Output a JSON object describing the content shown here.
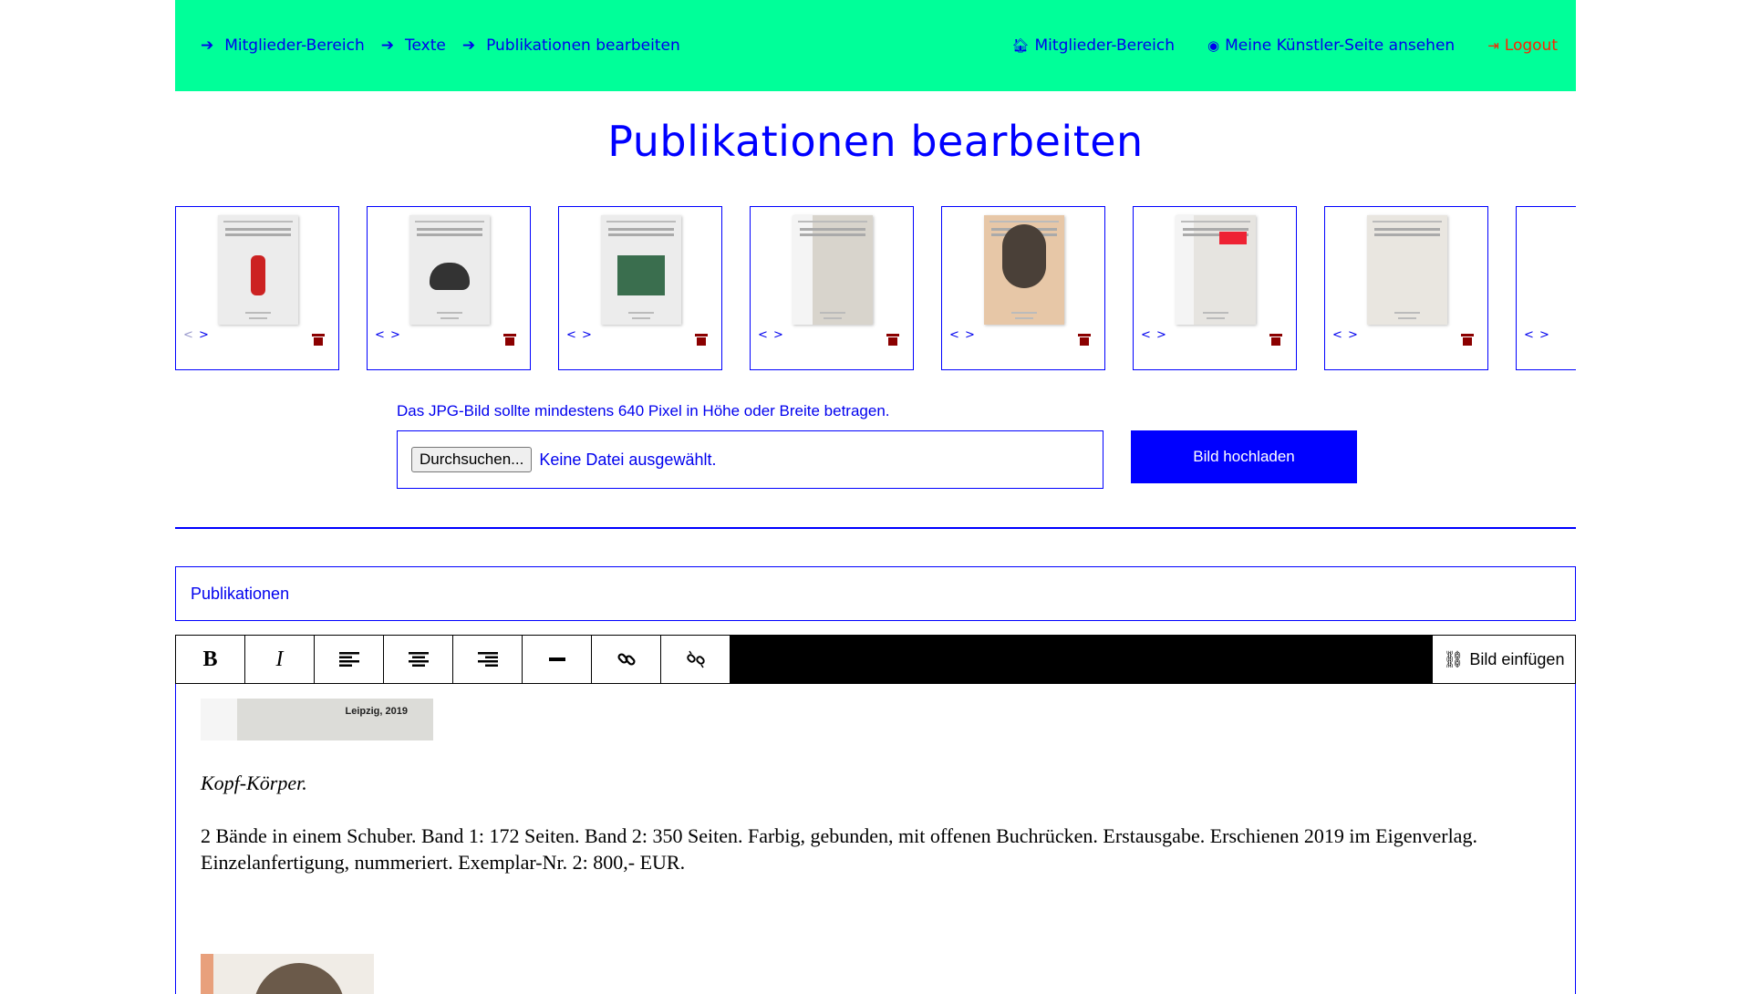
{
  "nav": {
    "breadcrumbs": [
      "Mitglieder-Bereich",
      "Texte",
      "Publikationen bearbeiten"
    ],
    "arrow": "➔",
    "links": [
      {
        "label": "Mitglieder-Bereich",
        "icon": "home-icon",
        "glyph": "🏠︎"
      },
      {
        "label": "Meine Künstler-Seite ansehen",
        "icon": "eye-icon",
        "glyph": "◉"
      }
    ],
    "logout": {
      "label": "Logout",
      "icon": "logout-icon",
      "glyph": "⇥"
    },
    "colors": {
      "bar": "#00ff99",
      "link": "#0000ee",
      "logout": "#ff2200"
    }
  },
  "page_title": "Publikationen bearbeiten",
  "thumbnails": [
    {
      "name": "book-fire-extinguisher",
      "controls": "< >"
    },
    {
      "name": "book-shell",
      "controls": "< >"
    },
    {
      "name": "book-landscape",
      "controls": "< >"
    },
    {
      "name": "book-spine",
      "controls": "< >"
    },
    {
      "name": "book-portrait",
      "controls": "< >"
    },
    {
      "name": "book-kopf-koerper",
      "controls": "< >"
    },
    {
      "name": "book-text-cover",
      "controls": "< >"
    },
    {
      "name": "book-partial",
      "controls": "< >"
    }
  ],
  "upload": {
    "hint": "Das JPG-Bild sollte mindestens 640 Pixel in Höhe oder Breite betragen.",
    "browse_label": "Durchsuchen...",
    "no_file": "Keine Datei ausgewählt.",
    "button": "Bild hochladen"
  },
  "title_field_value": "Publikationen",
  "toolbar": {
    "bold": "B",
    "italic": "I",
    "insert_image": "Bild einfügen"
  },
  "editor": {
    "image_caption": "Leipzig, 2019",
    "pub_title": "Kopf-Körper.",
    "pub_desc": "2 Bände in einem Schuber. Band 1: 172 Seiten. Band 2: 350 Seiten. Farbig, gebunden, mit offenen Buchrücken. Erstausgabe. Erschienen 2019 im Eigenverlag. Einzelanfertigung, nummeriert. Exemplar-Nr. 2: 800,- EUR."
  }
}
